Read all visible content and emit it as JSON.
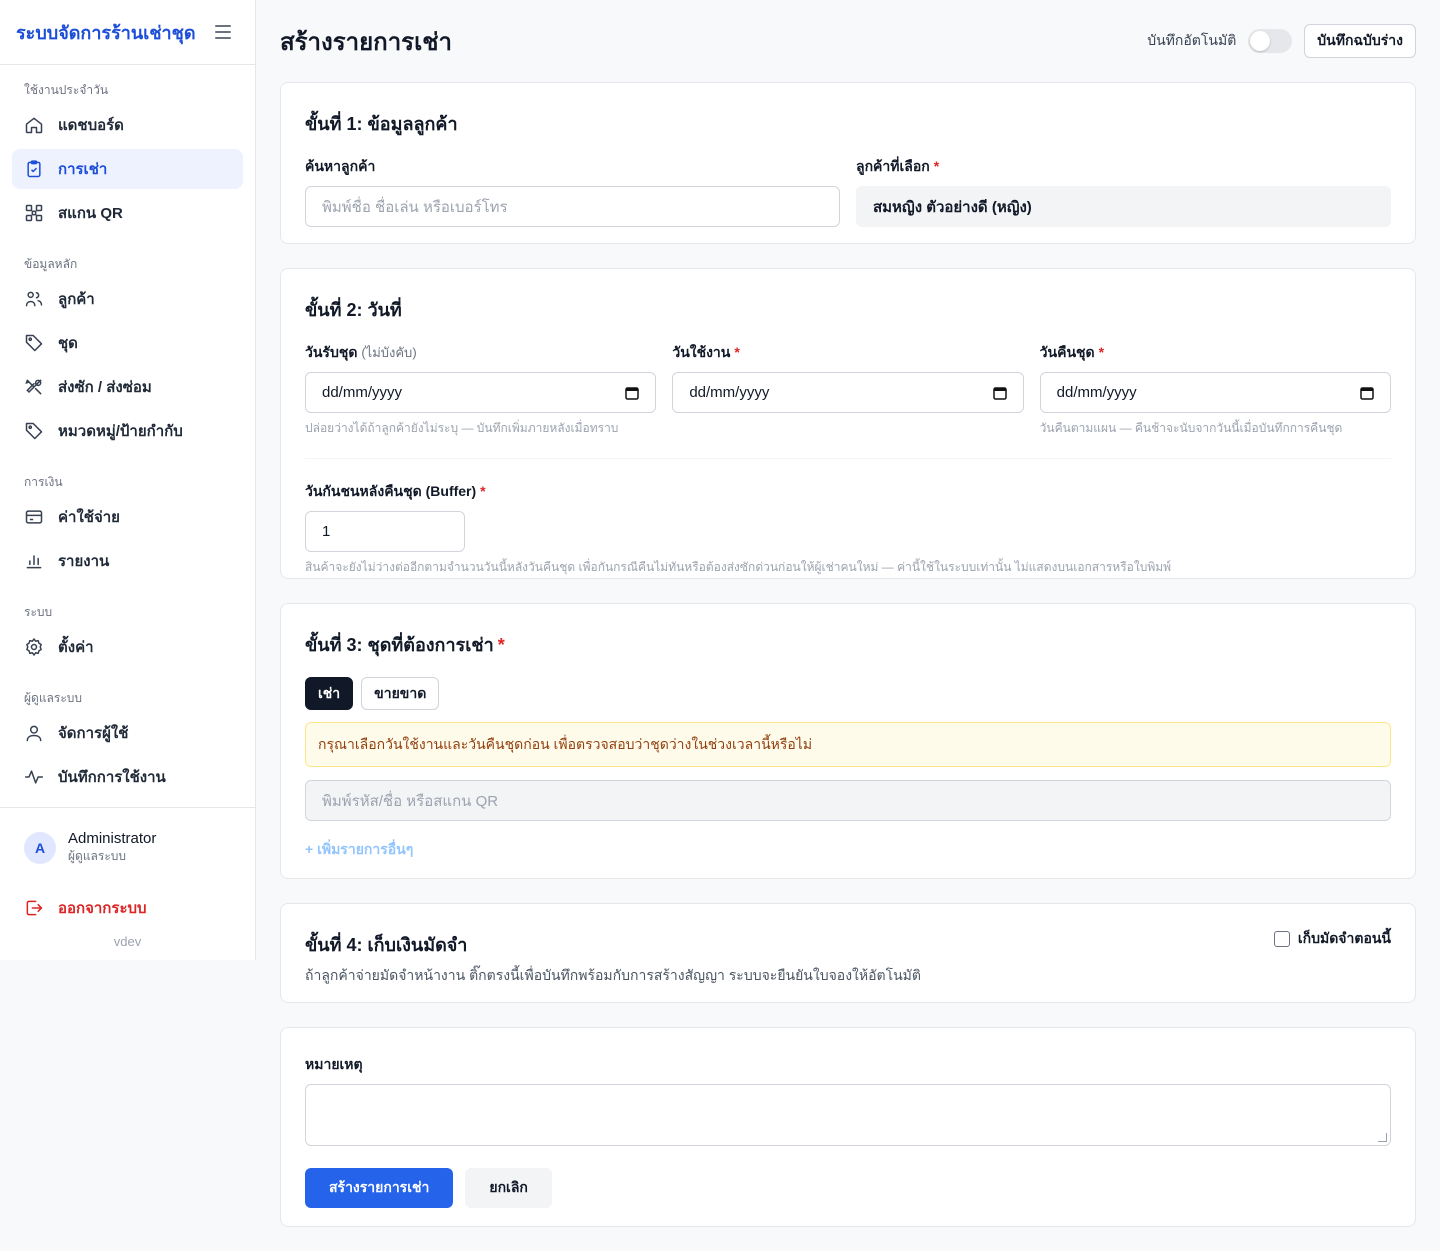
{
  "app": {
    "brand": "ระบบจัดการร้านเช่าชุด",
    "version": "vdev"
  },
  "sidebar": {
    "sections": [
      {
        "title": "ใช้งานประจำวัน",
        "items": [
          {
            "label": "แดชบอร์ด",
            "icon": "home-icon"
          },
          {
            "label": "การเช่า",
            "icon": "clipboard-icon",
            "active": true
          },
          {
            "label": "สแกน QR",
            "icon": "qr-icon"
          }
        ]
      },
      {
        "title": "ข้อมูลหลัก",
        "items": [
          {
            "label": "ลูกค้า",
            "icon": "users-icon"
          },
          {
            "label": "ชุด",
            "icon": "tag-icon"
          },
          {
            "label": "ส่งซัก / ส่งซ่อม",
            "icon": "tools-icon"
          },
          {
            "label": "หมวดหมู่/ป้ายกำกับ",
            "icon": "tag-icon"
          }
        ]
      },
      {
        "title": "การเงิน",
        "items": [
          {
            "label": "ค่าใช้จ่าย",
            "icon": "credit-card-icon"
          },
          {
            "label": "รายงาน",
            "icon": "bar-chart-icon"
          }
        ]
      },
      {
        "title": "ระบบ",
        "items": [
          {
            "label": "ตั้งค่า",
            "icon": "gear-icon"
          }
        ]
      },
      {
        "title": "ผู้ดูแลระบบ",
        "items": [
          {
            "label": "จัดการผู้ใช้",
            "icon": "user-icon"
          },
          {
            "label": "บันทึกการใช้งาน",
            "icon": "activity-icon"
          }
        ]
      }
    ],
    "user": {
      "initial": "A",
      "name": "Administrator",
      "role": "ผู้ดูแลระบบ"
    },
    "logout": "ออกจากระบบ"
  },
  "header": {
    "title": "สร้างรายการเช่า",
    "autosave_label": "บันทึกอัตโนมัติ",
    "draft_button": "บันทึกฉบับร่าง"
  },
  "step1": {
    "title": "ขั้นที่ 1: ข้อมูลลูกค้า",
    "search_label": "ค้นหาลูกค้า",
    "search_placeholder": "พิมพ์ชื่อ ชื่อเล่น หรือเบอร์โทร",
    "selected_label": "ลูกค้าที่เลือก",
    "selected_value": "สมหญิง ตัวอย่างดี (หญิง)"
  },
  "step2": {
    "title": "ขั้นที่ 2: วันที่",
    "pickup_label": "วันรับชุด",
    "pickup_optional": "(ไม่บังคับ)",
    "pickup_value": "dd/mm/yyyy",
    "pickup_hint": "ปล่อยว่างได้ถ้าลูกค้ายังไม่ระบุ — บันทึกเพิ่มภายหลังเมื่อทราบ",
    "use_label": "วันใช้งาน",
    "use_value": "dd/mm/yyyy",
    "return_label": "วันคืนชุด",
    "return_value": "dd/mm/yyyy",
    "return_hint": "วันคืนตามแผน — คืนช้าจะนับจากวันนี้เมื่อบันทึกการคืนชุด",
    "buffer_label": "วันกันชนหลังคืนชุด (Buffer)",
    "buffer_value": "1",
    "buffer_hint": "สินค้าจะยังไม่ว่างต่ออีกตามจำนวนวันนี้หลังวันคืนชุด เพื่อกันกรณีคืนไม่ทันหรือต้องส่งซักด่วนก่อนให้ผู้เช่าคนใหม่ — ค่านี้ใช้ในระบบเท่านั้น ไม่แสดงบนเอกสารหรือใบพิมพ์"
  },
  "step3": {
    "title": "ขั้นที่ 3: ชุดที่ต้องการเช่า",
    "tab_rent": "เช่า",
    "tab_sell": "ขายขาด",
    "alert": "กรุณาเลือกวันใช้งานและวันคืนชุดก่อน เพื่อตรวจสอบว่าชุดว่างในช่วงเวลานี้หรือไม่",
    "item_placeholder": "พิมพ์รหัส/ชื่อ หรือสแกน QR",
    "add_more": "+ เพิ่มรายการอื่นๆ"
  },
  "step4": {
    "title": "ขั้นที่ 4: เก็บเงินมัดจำ",
    "checkbox_label": "เก็บมัดจำตอนนี้",
    "description": "ถ้าลูกค้าจ่ายมัดจำหน้างาน ติ๊กตรงนี้เพื่อบันทึกพร้อมกับการสร้างสัญญา ระบบจะยืนยันใบจองให้อัตโนมัติ"
  },
  "notes": {
    "label": "หมายเหตุ",
    "submit": "สร้างรายการเช่า",
    "cancel": "ยกเลิก"
  },
  "colors": {
    "accent": "#2563eb",
    "brand": "#1d4ed8",
    "danger": "#dc2626"
  }
}
